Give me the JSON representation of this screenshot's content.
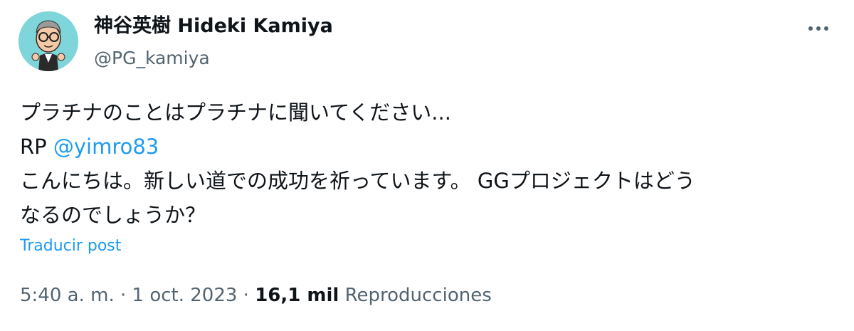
{
  "author": {
    "display_name": "神谷英樹 Hideki Kamiya",
    "handle": "@PG_kamiya",
    "avatar_icon": "cartoon-avatar-icon",
    "avatar_bg": "#7fd6da"
  },
  "more_icon": "more-horizontal-icon",
  "tweet": {
    "text": "プラチナのことはプラチナに聞いてください...",
    "reply_prefix": "RP ",
    "reply_mention": "@yimro83",
    "quoted_line1": "こんにちは。新しい道での成功を祈っています。 GGプロジェクトはどう",
    "quoted_line2": "なるのでしょうか？"
  },
  "translate_label": "Traducir post",
  "meta": {
    "time": "5:40 a. m.",
    "sep1": " · ",
    "date": "1 oct. 2023",
    "sep2": " · ",
    "views_count": "16,1 mil",
    "views_label": " Reproducciones"
  },
  "colors": {
    "link": "#1d9bf0",
    "text": "#0f1419",
    "secondary": "#536471"
  }
}
